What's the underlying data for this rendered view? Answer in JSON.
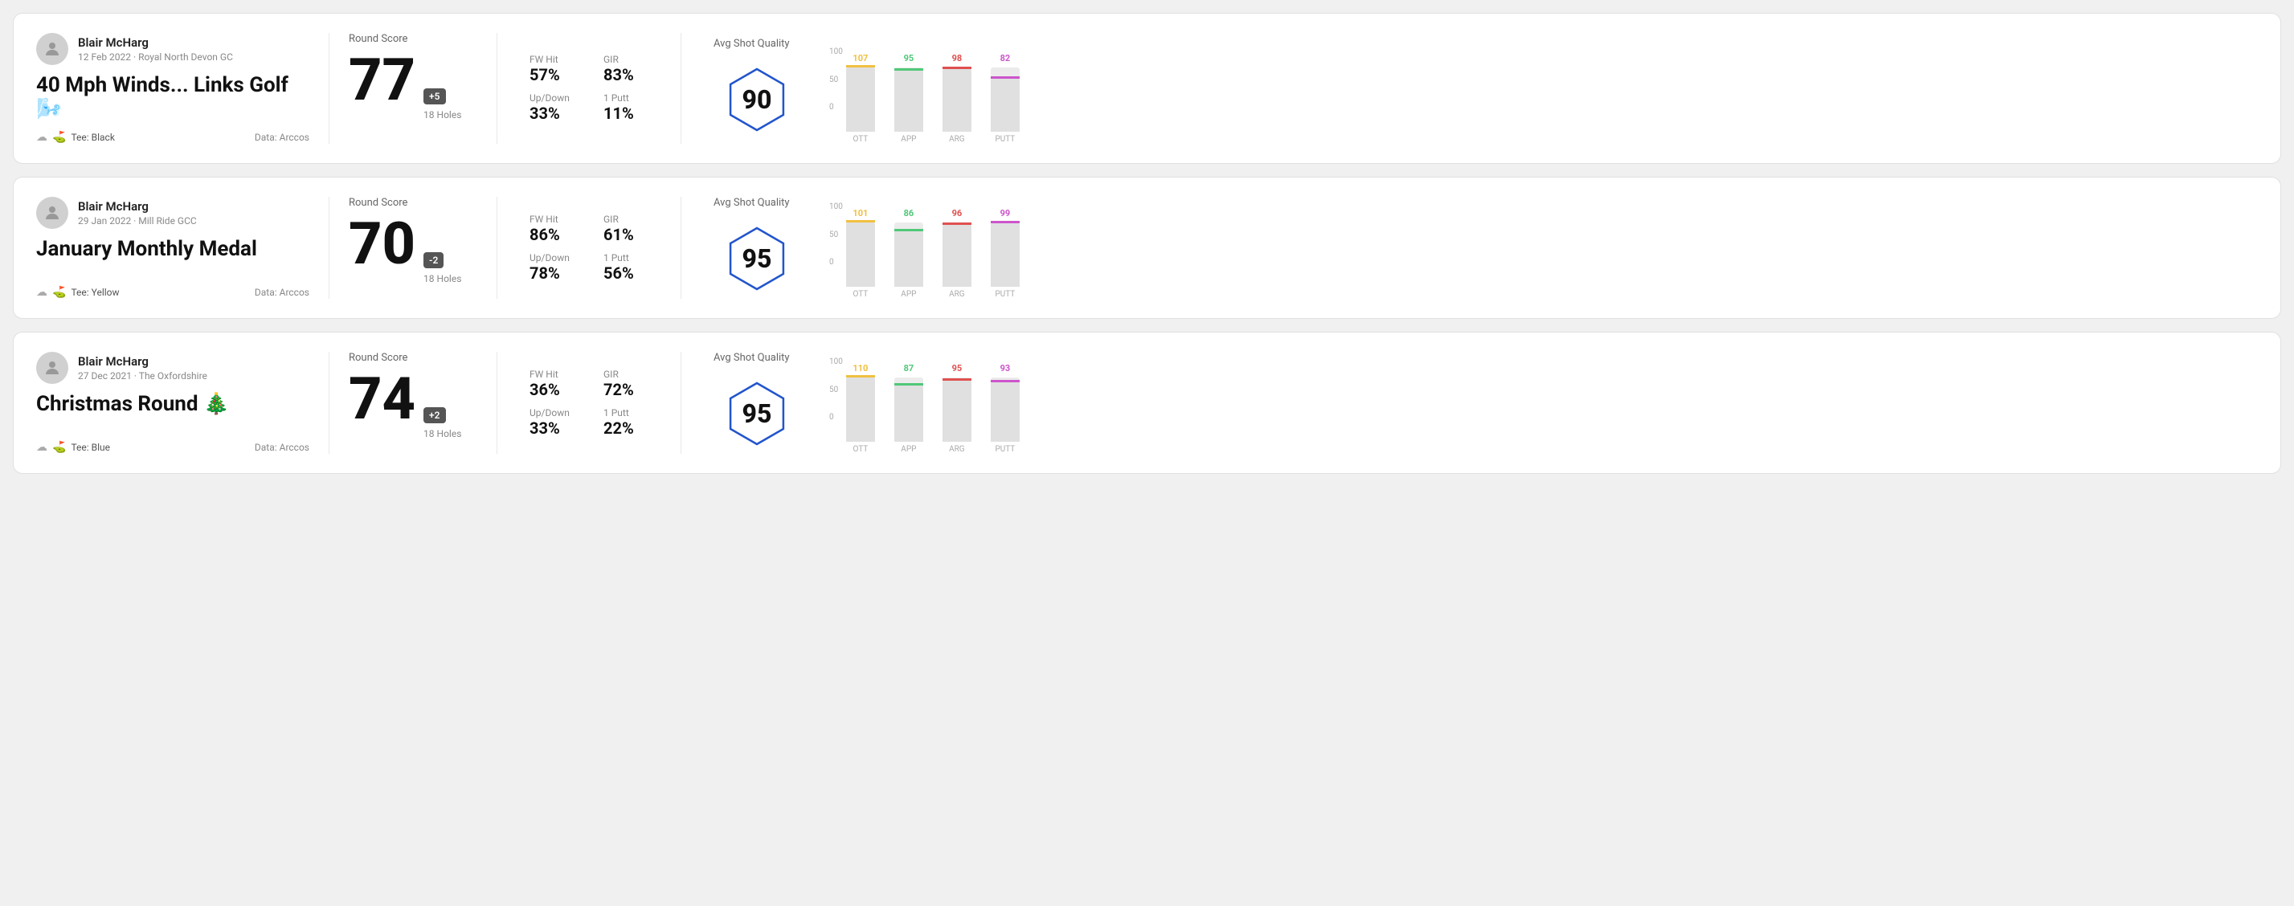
{
  "rounds": [
    {
      "id": "round-1",
      "user": {
        "name": "Blair McHarg",
        "date": "12 Feb 2022",
        "course": "Royal North Devon GC"
      },
      "title": "40 Mph Winds... Links Golf 🌬️",
      "tee": "Black",
      "data_source": "Data: Arccos",
      "score": {
        "value": "77",
        "modifier": "+5",
        "holes": "18 Holes",
        "label": "Round Score"
      },
      "stats": {
        "fw_hit_label": "FW Hit",
        "fw_hit_value": "57%",
        "gir_label": "GIR",
        "gir_value": "83%",
        "updown_label": "Up/Down",
        "updown_value": "33%",
        "oneputt_label": "1 Putt",
        "oneputt_value": "11%"
      },
      "quality": {
        "label": "Avg Shot Quality",
        "score": "90"
      },
      "chart": {
        "bars": [
          {
            "label": "OTT",
            "value": 107,
            "color": "#f0c040",
            "max": 100
          },
          {
            "label": "APP",
            "value": 95,
            "color": "#50c878",
            "max": 100
          },
          {
            "label": "ARG",
            "value": 98,
            "color": "#e05050",
            "max": 100
          },
          {
            "label": "PUTT",
            "value": 82,
            "color": "#cc55cc",
            "max": 100
          }
        ],
        "y_labels": [
          "100",
          "50",
          "0"
        ]
      }
    },
    {
      "id": "round-2",
      "user": {
        "name": "Blair McHarg",
        "date": "29 Jan 2022",
        "course": "Mill Ride GCC"
      },
      "title": "January Monthly Medal",
      "tee": "Yellow",
      "data_source": "Data: Arccos",
      "score": {
        "value": "70",
        "modifier": "-2",
        "holes": "18 Holes",
        "label": "Round Score"
      },
      "stats": {
        "fw_hit_label": "FW Hit",
        "fw_hit_value": "86%",
        "gir_label": "GIR",
        "gir_value": "61%",
        "updown_label": "Up/Down",
        "updown_value": "78%",
        "oneputt_label": "1 Putt",
        "oneputt_value": "56%"
      },
      "quality": {
        "label": "Avg Shot Quality",
        "score": "95"
      },
      "chart": {
        "bars": [
          {
            "label": "OTT",
            "value": 101,
            "color": "#f0c040",
            "max": 100
          },
          {
            "label": "APP",
            "value": 86,
            "color": "#50c878",
            "max": 100
          },
          {
            "label": "ARG",
            "value": 96,
            "color": "#e05050",
            "max": 100
          },
          {
            "label": "PUTT",
            "value": 99,
            "color": "#cc55cc",
            "max": 100
          }
        ],
        "y_labels": [
          "100",
          "50",
          "0"
        ]
      }
    },
    {
      "id": "round-3",
      "user": {
        "name": "Blair McHarg",
        "date": "27 Dec 2021",
        "course": "The Oxfordshire"
      },
      "title": "Christmas Round 🎄",
      "tee": "Blue",
      "data_source": "Data: Arccos",
      "score": {
        "value": "74",
        "modifier": "+2",
        "holes": "18 Holes",
        "label": "Round Score"
      },
      "stats": {
        "fw_hit_label": "FW Hit",
        "fw_hit_value": "36%",
        "gir_label": "GIR",
        "gir_value": "72%",
        "updown_label": "Up/Down",
        "updown_value": "33%",
        "oneputt_label": "1 Putt",
        "oneputt_value": "22%"
      },
      "quality": {
        "label": "Avg Shot Quality",
        "score": "95"
      },
      "chart": {
        "bars": [
          {
            "label": "OTT",
            "value": 110,
            "color": "#f0c040",
            "max": 100
          },
          {
            "label": "APP",
            "value": 87,
            "color": "#50c878",
            "max": 100
          },
          {
            "label": "ARG",
            "value": 95,
            "color": "#e05050",
            "max": 100
          },
          {
            "label": "PUTT",
            "value": 93,
            "color": "#cc55cc",
            "max": 100
          }
        ],
        "y_labels": [
          "100",
          "50",
          "0"
        ]
      }
    }
  ]
}
